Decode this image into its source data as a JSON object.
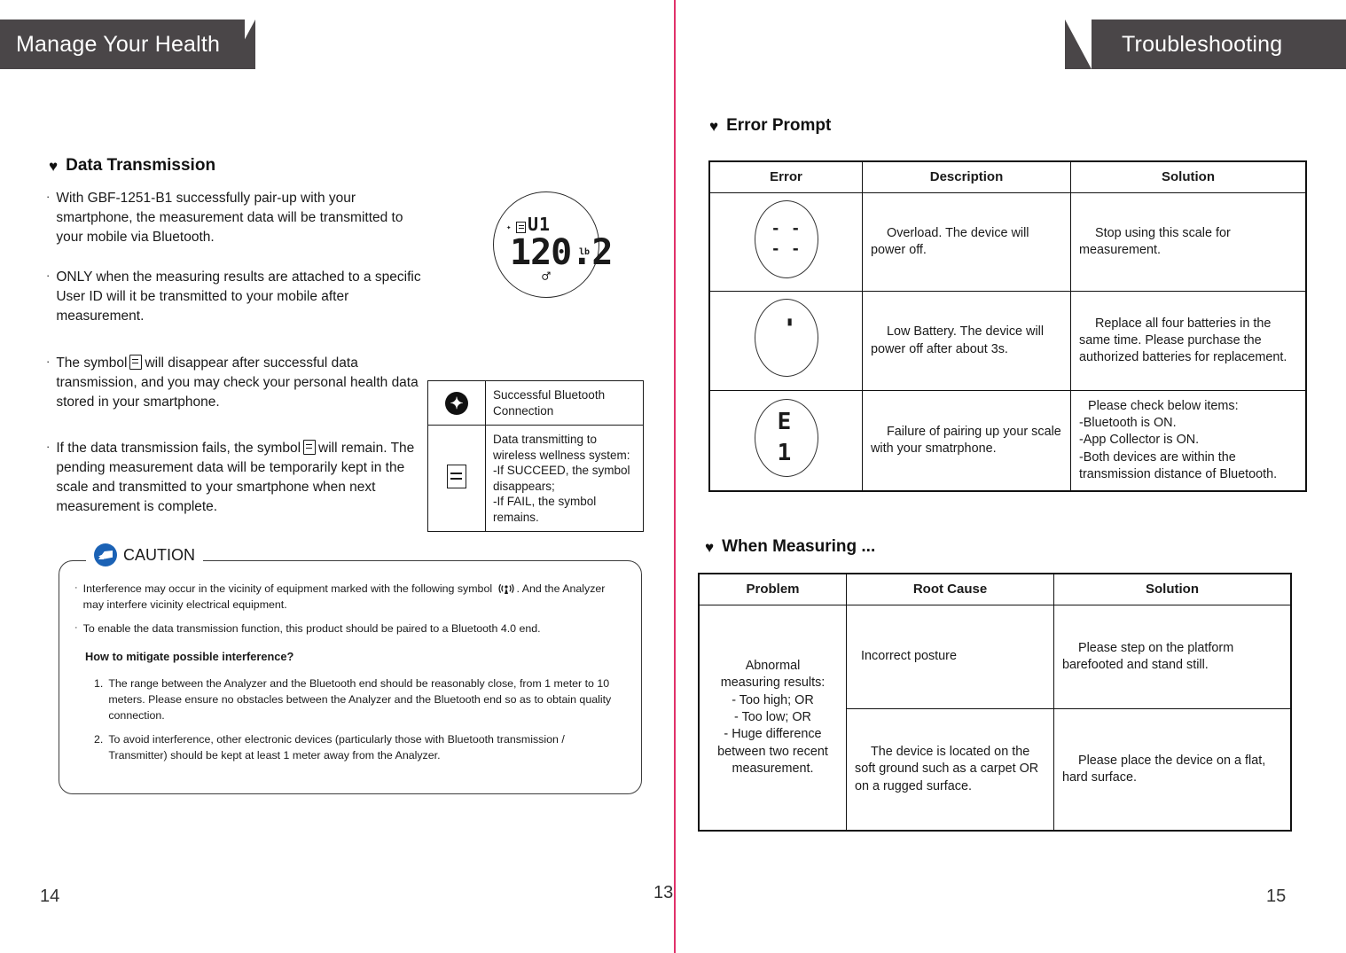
{
  "left_page": {
    "banner_title": "Manage Your Health",
    "page_number": "14",
    "section": {
      "heading": "Data Transmission",
      "heart_icon": "heart-icon",
      "bullets": [
        {
          "dot": "·",
          "text": "With GBF-1251-B1 successfully pair-up with your smartphone, the measurement data will be transmitted to your mobile via Bluetooth."
        },
        {
          "dot": "·",
          "text": "ONLY when the measuring results are attached to a specific User ID will it be transmitted to your mobile after measurement."
        }
      ],
      "bullet3_a": "The symbol",
      "bullet3_b": "will disappear after successful data transmission, and you may check your personal health data stored in your smartphone.",
      "bullet4_a": "If the data transmission fails, the symbol",
      "bullet4_b": "will remain. The pending measurement data will be temporarily kept in the scale and transmitted to your smartphone when next measurement is complete."
    },
    "lcd": {
      "bluetooth": "ᛗ",
      "user_id": "U1",
      "weight": "120.2",
      "unit": "lb",
      "body_icon": "person-icon"
    },
    "legend": [
      {
        "icon": "bluetooth-icon",
        "text": "Successful Bluetooth Connection"
      },
      {
        "icon": "document-icon",
        "text": "Data transmitting to wireless wellness system:\n-If SUCCEED, the symbol disappears;\n-If FAIL, the symbol remains."
      }
    ],
    "caution": {
      "title": "CAUTION",
      "icon": "consult-manual-icon",
      "bullets": [
        {
          "dot": "·",
          "before": "Interference may occur in the vicinity of equipment marked with the following symbol",
          "after": ". And the Analyzer may interfere vicinity electrical equipment."
        },
        {
          "dot": "·",
          "text": "To enable the data transmission function, this product should be paired to a Bluetooth 4.0 end."
        }
      ],
      "subheading": "How to mitigate possible interference?",
      "numbered": [
        {
          "n": "1.",
          "text": "The range between the Analyzer and the Bluetooth end should be reasonably close, from 1 meter to 10 meters. Please ensure no obstacles between the Analyzer and the Bluetooth end so as to obtain quality connection."
        },
        {
          "n": "2.",
          "text": "To avoid interference, other electronic devices (particularly those with Bluetooth transmission / Transmitter) should be kept at least 1 meter away from the Analyzer."
        }
      ]
    }
  },
  "middle_page_number": "13",
  "right_page": {
    "banner_title": "Troubleshooting",
    "page_number": "15",
    "error_prompt": {
      "heading": "Error Prompt",
      "heart_icon": "heart-icon",
      "columns": [
        "Error",
        "Description",
        "Solution"
      ],
      "rows": [
        {
          "symbol": "- - - -",
          "symbol_kind": "dashes",
          "description": "Overload. The device will power off.",
          "solution": "Stop using this scale for measurement."
        },
        {
          "symbol": "battery",
          "symbol_kind": "battery",
          "description": "Low Battery. The device will power off after about 3s.",
          "solution": "Replace all four batteries in the same time. Please purchase the authorized batteries for replacement."
        },
        {
          "symbol": "E 1",
          "symbol_kind": "code",
          "description": "Failure of pairing up your scale with your smatrphone.",
          "solution": "Please check below items:\n-Bluetooth is ON.\n-App Collector is ON.\n-Both devices are within the transmission distance of Bluetooth."
        }
      ]
    },
    "when_measuring": {
      "heading": "When Measuring ...",
      "heart_icon": "heart-icon",
      "columns": [
        "Problem",
        "Root Cause",
        "Solution"
      ],
      "problem": "Abnormal\nmeasuring results:\n- Too high; OR\n- Too low; OR\n- Huge difference\nbetween two recent\nmeasurement.",
      "rows": [
        {
          "root_cause": "Incorrect posture",
          "solution": "Please step on the platform barefooted and stand still."
        },
        {
          "root_cause": "The device is located on the soft ground such as a carpet OR on a rugged surface.",
          "solution": "Please place the device on a flat, hard surface."
        }
      ]
    }
  },
  "colors": {
    "banner": "#4a4648",
    "spine": "#e0316a",
    "caution_icon": "#1b62b5",
    "text": "#1a1a1a"
  }
}
